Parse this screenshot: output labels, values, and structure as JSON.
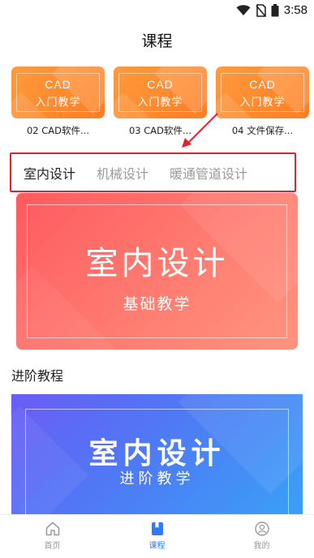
{
  "status_bar": {
    "time": "3:58"
  },
  "header": {
    "title": "课程"
  },
  "courses": [
    {
      "thumb_line1": "CAD",
      "thumb_line2": "入门教学",
      "name": "02 CAD软件..."
    },
    {
      "thumb_line1": "CAD",
      "thumb_line2": "入门教学",
      "name": "03 CAD软件..."
    },
    {
      "thumb_line1": "CAD",
      "thumb_line2": "入门教学",
      "name": "04 文件保存..."
    }
  ],
  "tabs": [
    {
      "label": "室内设计",
      "active": true
    },
    {
      "label": "机械设计",
      "active": false
    },
    {
      "label": "暖通管道设计",
      "active": false
    }
  ],
  "hero": {
    "title": "室内设计",
    "subtitle": "基础教学"
  },
  "advanced": {
    "section_title": "进阶教程",
    "banner_title": "室内设计",
    "banner_subtitle": "进阶教学"
  },
  "bottom_nav": [
    {
      "label": "首页",
      "icon": "home-icon",
      "active": false
    },
    {
      "label": "课程",
      "icon": "book-icon",
      "active": true
    },
    {
      "label": "我的",
      "icon": "profile-icon",
      "active": false
    }
  ],
  "colors": {
    "accent_blue": "#2f7cf6",
    "highlight_red": "#e8202a",
    "course_orange": "#ff8a2a",
    "hero_red": "#ff6b68",
    "hero2_blue": "#4f79f5"
  }
}
